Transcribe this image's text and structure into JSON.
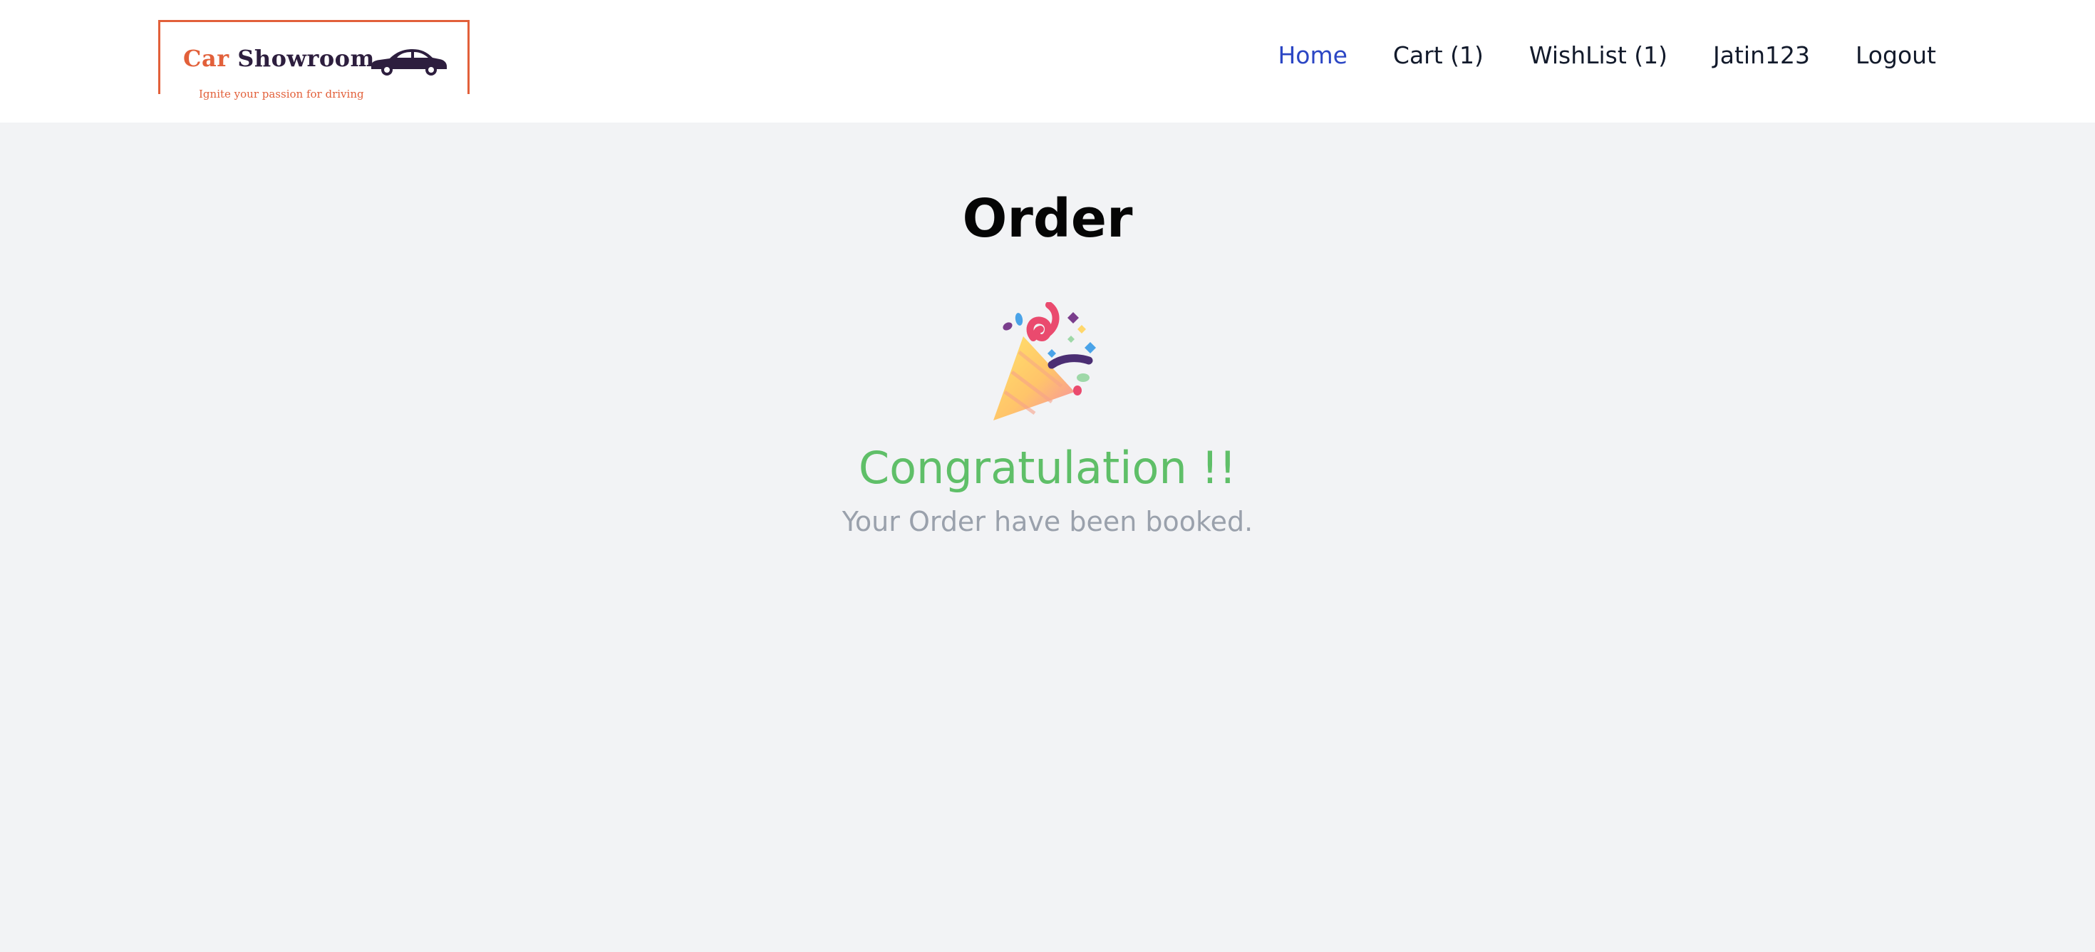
{
  "brand": {
    "name_part1": "Car",
    "name_part2": "Showroom",
    "tagline": "Ignite your passion for driving",
    "logo_icon": "car-icon",
    "accent_color": "#e2603a",
    "dark_color": "#2d1e3e"
  },
  "nav": {
    "items": [
      {
        "label": "Home",
        "active": true
      },
      {
        "label": "Cart (1)",
        "active": false
      },
      {
        "label": "WishList (1)",
        "active": false
      },
      {
        "label": "Jatin123",
        "active": false
      },
      {
        "label": "Logout",
        "active": false
      }
    ],
    "active_color": "#2b46c4"
  },
  "page": {
    "title": "Order",
    "celebration_icon": "party-popper-icon",
    "congrats_text": "Congratulation !!",
    "congrats_color": "#5fbf68",
    "message": "Your Order have been booked."
  }
}
